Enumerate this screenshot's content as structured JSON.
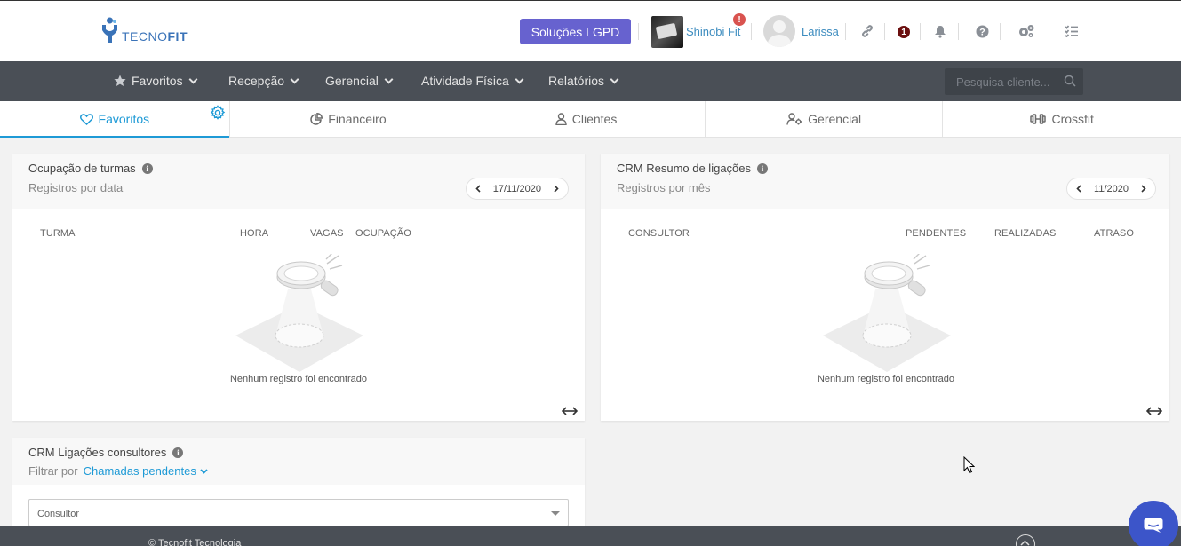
{
  "header": {
    "logo_prefix": "TECNO",
    "logo_suffix": "FIT",
    "lgpd_button": "Soluções LGPD",
    "branch_name": "Shinobi Fit",
    "branch_alert": "!",
    "user_name": "Larissa",
    "notification_count": "1",
    "icons": [
      "link-icon",
      "bell-icon",
      "help-icon",
      "settings-cogs-icon",
      "checklist-icon"
    ]
  },
  "nav": {
    "items": [
      {
        "label": "Favoritos",
        "icon": "star-icon"
      },
      {
        "label": "Recepção"
      },
      {
        "label": "Gerencial"
      },
      {
        "label": "Atividade Física"
      },
      {
        "label": "Relatórios"
      }
    ],
    "search_placeholder": "Pesquisa cliente..."
  },
  "tabs": [
    {
      "label": "Favoritos",
      "icon": "heart-icon",
      "active": true
    },
    {
      "label": "Financeiro",
      "icon": "pie-chart-icon"
    },
    {
      "label": "Clientes",
      "icon": "user-icon"
    },
    {
      "label": "Gerencial",
      "icon": "user-cog-icon"
    },
    {
      "label": "Crossfit",
      "icon": "dumbbell-icon"
    }
  ],
  "cards": {
    "turmas": {
      "title": "Ocupação de turmas",
      "subtitle": "Registros por data",
      "date": "17/11/2020",
      "columns": [
        "TURMA",
        "HORA",
        "VAGAS",
        "OCUPAÇÃO"
      ],
      "empty": "Nenhum registro foi encontrado"
    },
    "crm_resumo": {
      "title": "CRM Resumo de ligações",
      "subtitle": "Registros por mês",
      "date": "11/2020",
      "columns": [
        "CONSULTOR",
        "PENDENTES",
        "REALIZADAS",
        "ATRASO"
      ],
      "empty": "Nenhum registro foi encontrado"
    },
    "crm_consultores": {
      "title": "CRM Ligações consultores",
      "filter_label": "Filtrar por",
      "filter_value": "Chamadas pendentes",
      "select_placeholder": "Consultor"
    }
  },
  "footer": {
    "copyright": "© Tecnofit Tecnologia"
  },
  "colors": {
    "accent": "#1e9ad6",
    "lgpd": "#6762cf",
    "navbar": "#4a4f56",
    "chat": "#3c55c9"
  }
}
